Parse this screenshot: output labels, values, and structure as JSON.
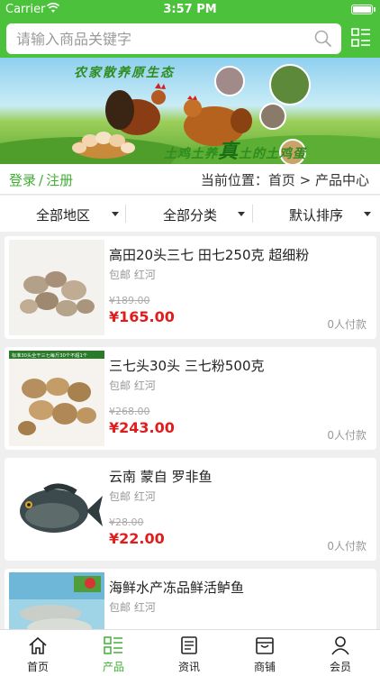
{
  "status_bar": {
    "carrier": "Carrier",
    "time": "3:57 PM"
  },
  "search": {
    "placeholder": "请输入商品关键字"
  },
  "banner": {
    "slogan_top": "农家散养原生态",
    "slogan_bottom_prefix": "土鸡土养",
    "slogan_bottom_big": "真",
    "slogan_bottom_suffix": "土的土鸡蛋"
  },
  "breadcrumb": {
    "login": "登录",
    "separator": "/",
    "register": "注册",
    "location": "当前位置：首页 > 产品中心"
  },
  "filters": [
    {
      "label": "全部地区"
    },
    {
      "label": "全部分类"
    },
    {
      "label": "默认排序"
    }
  ],
  "products": [
    {
      "title": "高田20头三七 田七250克 超细粉",
      "meta": "包邮 红河",
      "old_price": "¥189.00",
      "price": "¥165.00",
      "paid": "0人付款",
      "image": "sanqi-root"
    },
    {
      "title": "三七头30头 三七粉500克",
      "meta": "包邮 红河",
      "old_price": "¥268.00",
      "price": "¥243.00",
      "paid": "0人付款",
      "image": "sanqi-root-labeled",
      "image_caption": "标准30头全干三七每斤30个不超1个"
    },
    {
      "title": "云南 蒙自 罗非鱼",
      "meta": "包邮 红河",
      "old_price": "¥28.00",
      "price": "¥22.00",
      "paid": "0人付款",
      "image": "tilapia-fish"
    },
    {
      "title": "海鲜水产冻品鲜活鲈鱼",
      "meta": "包邮 红河",
      "old_price": "",
      "price": "",
      "paid": "",
      "image": "seabass-fish"
    }
  ],
  "tabs": [
    {
      "label": "首页",
      "icon": "home-icon",
      "active": false
    },
    {
      "label": "产品",
      "icon": "grid-list-icon",
      "active": true
    },
    {
      "label": "资讯",
      "icon": "news-icon",
      "active": false
    },
    {
      "label": "商铺",
      "icon": "shop-icon",
      "active": false
    },
    {
      "label": "会员",
      "icon": "user-icon",
      "active": false
    }
  ],
  "colors": {
    "brand_green": "#4cc23c",
    "price_red": "#e01d1d",
    "active_tab": "#3fb032"
  }
}
